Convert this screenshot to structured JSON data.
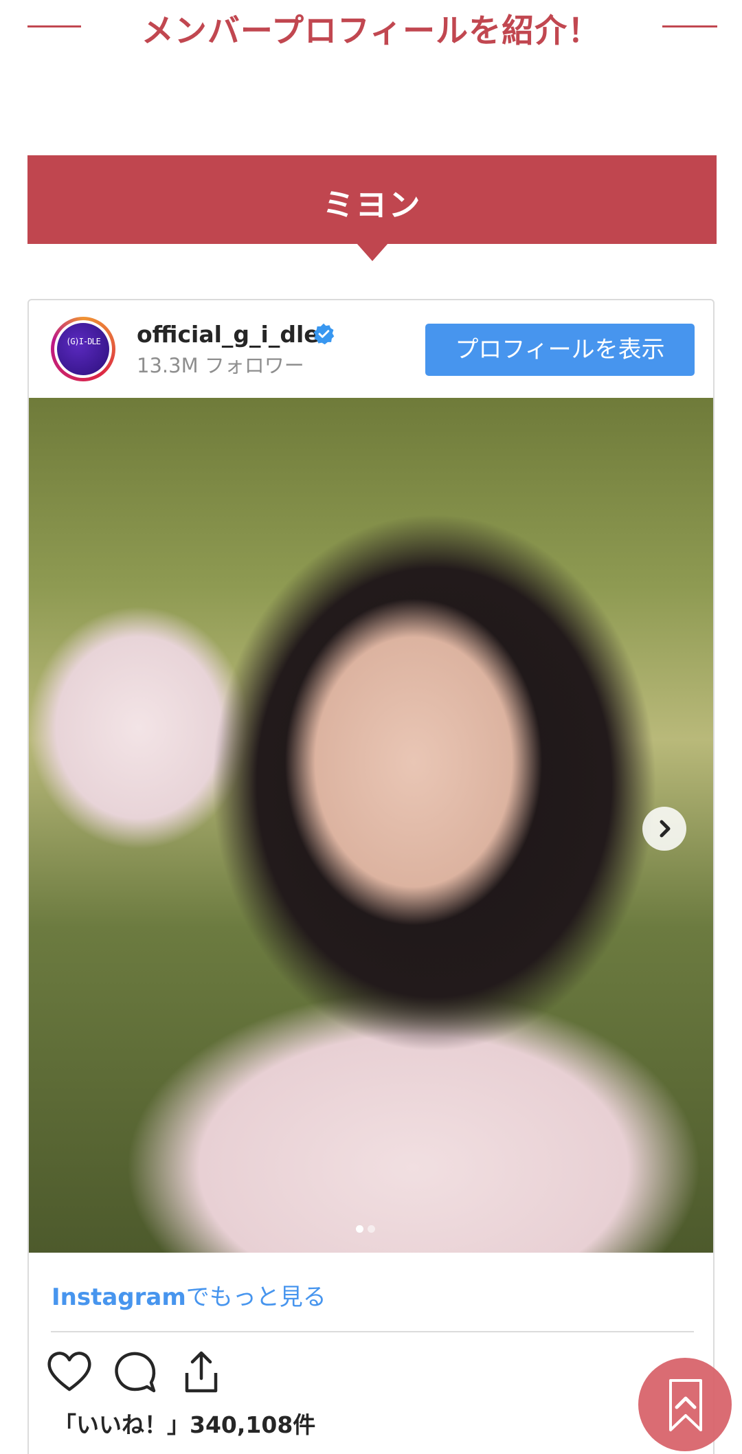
{
  "section": {
    "heading": "メンバープロフィールを紹介！"
  },
  "member": {
    "name": "ミヨン"
  },
  "instagram": {
    "username": "official_g_i_dle",
    "avatar_text": "(G)I-DLE",
    "followers": "13.3M フォロワー",
    "profile_button": "プロフィールを表示",
    "more_link_brand": "Instagram",
    "more_link_rest": "でもっと見る",
    "likes": "「いいね！」340,108件",
    "carousel": {
      "current": 1,
      "total": 2
    }
  },
  "icons": [
    "verified-badge-icon",
    "chevron-right-icon",
    "heart-icon",
    "comment-icon",
    "share-icon",
    "arrow-up-icon"
  ],
  "colors": {
    "accent": "#c0464f",
    "instagram_blue": "#4795ee",
    "back_to_top": "#d9656c"
  }
}
